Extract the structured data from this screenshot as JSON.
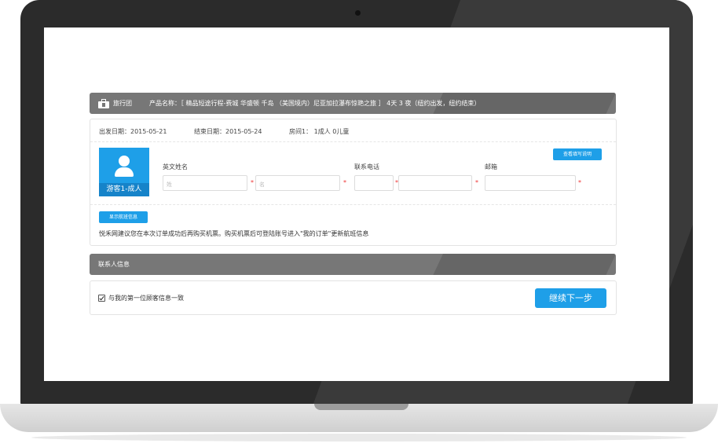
{
  "header": {
    "tour_label": "旅行团",
    "product_text": "产品名称：［ 精品短途行程-费城 华盛顿 千岛 （美国境内）尼亚加拉瀑布惊艳之旅 ］ 4天 3 夜（纽约出发，纽约结束）"
  },
  "trip": {
    "depart": "出发日期：2015-05-21",
    "end": "结束日期：2015-05-24",
    "room": "房间1： 1成人  0儿童"
  },
  "guest": {
    "avatar_label": "游客1-成人",
    "name_label": "英文姓名",
    "surname_placeholder": "姓",
    "given_placeholder": "名",
    "phone_label": "联系电话",
    "email_label": "邮箱",
    "help_button": "查看填写说明",
    "flight_button": "显示航班信息",
    "required_mark": "*"
  },
  "note": "悦禾网建议您在本次订单成功后再购买机票。购买机票后可登陆账号进入\"我的订单\"更新航班信息",
  "contact": {
    "title": "联系人信息",
    "same_as_first": "与我的第一位顾客信息一致",
    "continue_button": "继续下一步"
  }
}
